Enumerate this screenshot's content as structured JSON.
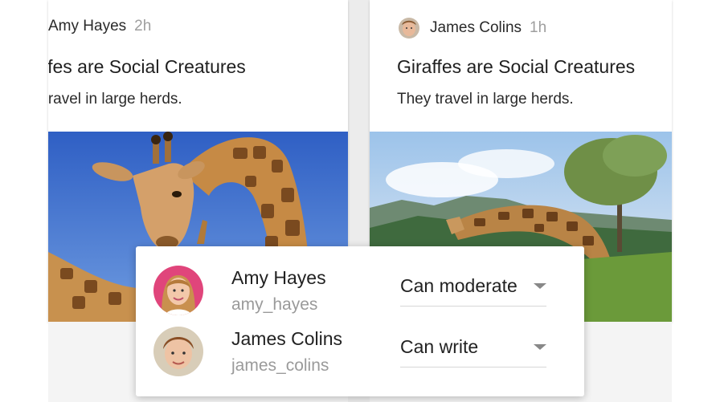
{
  "cards": [
    {
      "author": "Amy Hayes",
      "time": "2h",
      "title": "iffes are Social Creatures",
      "description": "/ travel in large herds."
    },
    {
      "author": "James Colins",
      "time": "1h",
      "title": "Giraffes are Social Creatures",
      "description": "They travel in large herds."
    }
  ],
  "members": [
    {
      "name": "Amy Hayes",
      "username": "amy_hayes",
      "permission": "Can moderate"
    },
    {
      "name": "James Colins",
      "username": "james_colins",
      "permission": "Can write"
    }
  ],
  "colors": {
    "card_background": "#ffffff",
    "page_background": "#ececec",
    "muted_text": "#9e9e9e",
    "primary_text": "#222222",
    "avatar_amy_ring": "#e0457b"
  },
  "icons": {
    "dropdown": "chevron-down-icon"
  }
}
